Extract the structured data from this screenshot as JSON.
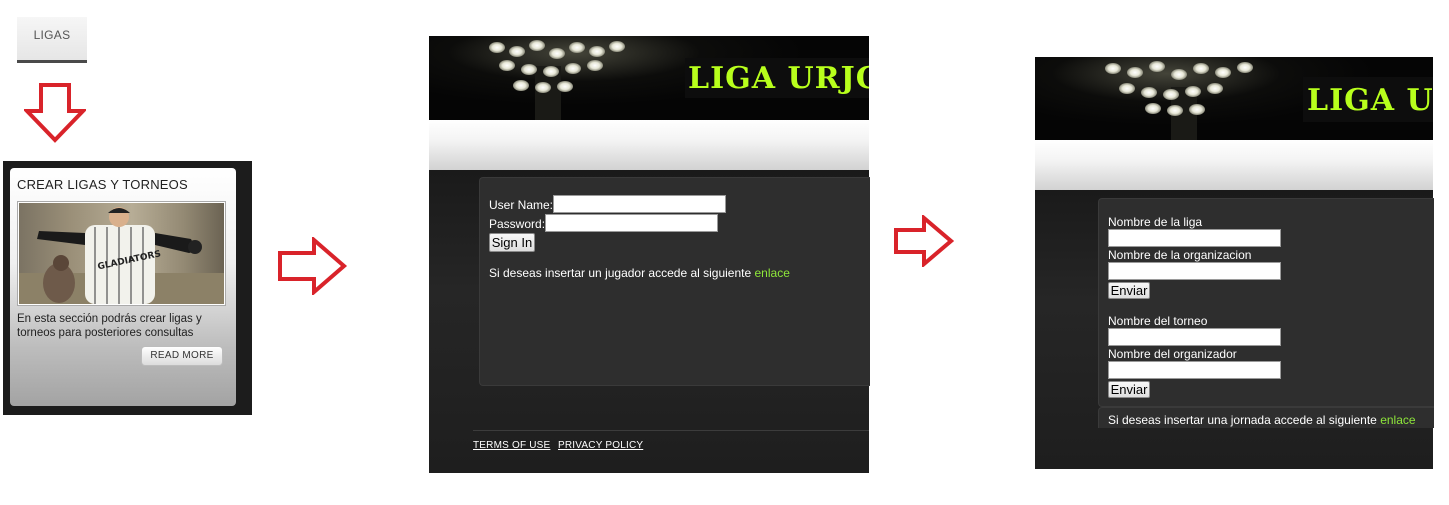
{
  "panel1": {
    "tab_label": "LIGAS",
    "card_title": "CREAR LIGAS Y TORNEOS",
    "card_description": "En esta sección podrás crear ligas y torneos para posteriores consultas",
    "read_more": "READ MORE",
    "photo_jersey_text": "GLADIATORS"
  },
  "login": {
    "logo": "LIGA URJC",
    "username_label": "User Name:",
    "password_label": "Password:",
    "sign_in": "Sign In",
    "info_text": "Si deseas insertar un jugador accede al siguiente ",
    "info_link": "enlace",
    "footer_terms": "TERMS OF USE",
    "footer_privacy": "PRIVACY POLICY"
  },
  "create": {
    "logo": "LIGA URJC",
    "league_name_label": "Nombre de la liga",
    "organization_label": "Nombre de la organizacion",
    "send_1": "Enviar",
    "tournament_name_label": "Nombre del torneo",
    "organizer_label": "Nombre del organizador",
    "send_2": "Enviar",
    "info_text": "Si deseas insertar una jornada accede al siguiente ",
    "info_link": "enlace"
  },
  "colors": {
    "arrow": "#d9232a",
    "logo": "#b8ff1c",
    "link": "#8ee63a"
  }
}
